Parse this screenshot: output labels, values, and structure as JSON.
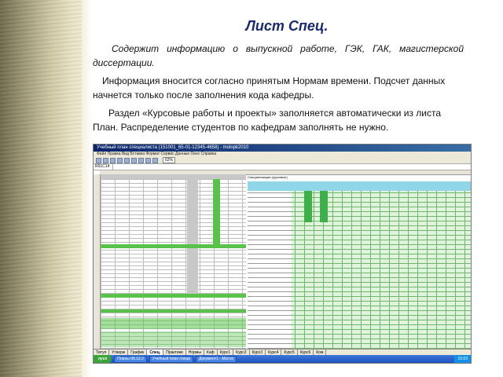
{
  "slide": {
    "title": "Лист Спец.",
    "paragraph1": "Содержит информацию о выпускной работе, ГЭК, ГАК, магистерской диссертации.",
    "paragraph2": "Информация вносится согласно принятым Нормам времени. Подсчет данных начнется только после заполнения кода кафедры.",
    "paragraph3": "Раздел «Курсовые работы и проекты» заполняется автоматически из листа План. Распределение студентов по кафедрам заполнять не нужно."
  },
  "excel": {
    "window_title": "Учебный план специалиста (151001_65-01-12345-4658) - molopk2010",
    "menu": "Файл  Правка  Вид  Вставка  Формат  Сервис  Данные  Окно  Справка",
    "zoom": "62%",
    "name_box": "R51C14",
    "section_title": "Специализации (курсовые)",
    "tabs": [
      "Титул",
      "Утверж",
      "График",
      "Спец.",
      "Практики",
      "Нормы",
      "Каф",
      "Курс1",
      "Курс2",
      "Курс3",
      "Курс4",
      "Курс5",
      "Курс6",
      "Ком"
    ],
    "active_tab": "Спец.",
    "taskbar": {
      "start": "пуск",
      "tasks": [
        "Планы 06.12.2",
        "Учебный план специ",
        "Документ1 - Micros"
      ],
      "clock": "15:03"
    }
  }
}
